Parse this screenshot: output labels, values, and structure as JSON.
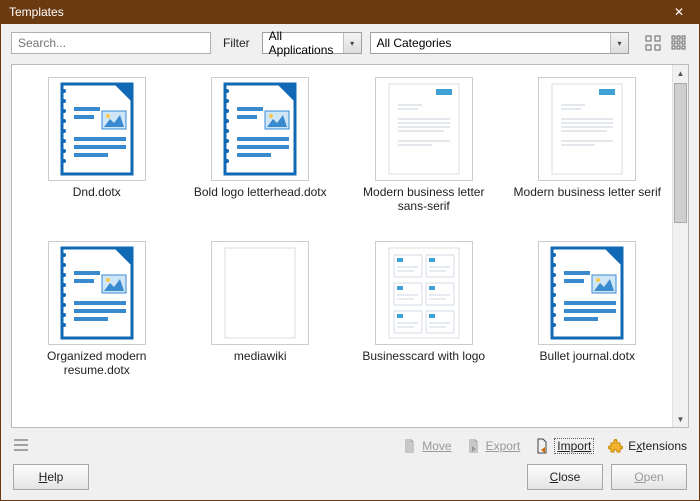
{
  "window": {
    "title": "Templates"
  },
  "toolbar": {
    "search_placeholder": "Search...",
    "filter_label": "Filter",
    "apps_value": "All Applications",
    "cats_value": "All Categories"
  },
  "items": [
    {
      "name": "Dnd.dotx",
      "thumb": "writer"
    },
    {
      "name": "Bold logo letterhead.dotx",
      "thumb": "writer"
    },
    {
      "name": "Modern business letter sans-serif",
      "thumb": "letter-blue"
    },
    {
      "name": "Modern business letter serif",
      "thumb": "letter-blue"
    },
    {
      "name": "Organized modern resume.dotx",
      "thumb": "writer"
    },
    {
      "name": "mediawiki",
      "thumb": "blank"
    },
    {
      "name": "Businesscard with logo",
      "thumb": "cards"
    },
    {
      "name": "Bullet journal.dotx",
      "thumb": "writer"
    }
  ],
  "actions": {
    "move": "Move",
    "export": "Export",
    "import": "Import",
    "ext": "Extensions"
  },
  "buttons": {
    "help": "Help",
    "close": "Close",
    "open": "Open"
  }
}
